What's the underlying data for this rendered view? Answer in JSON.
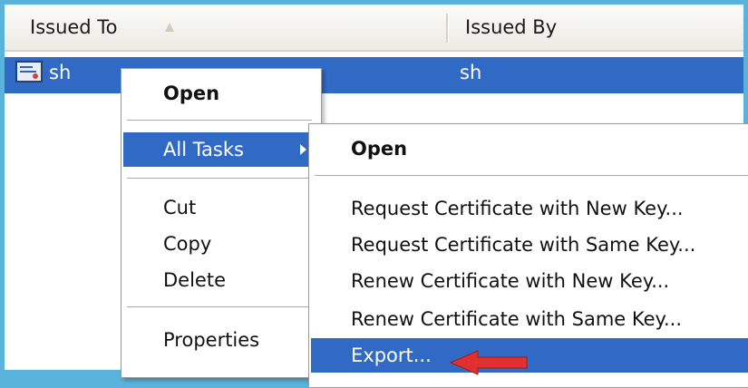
{
  "list": {
    "columns": {
      "issued_to": "Issued To",
      "issued_by": "Issued By"
    },
    "sort_icon": "sort-ascending-icon",
    "selected_row": {
      "issued_to": "sh",
      "issued_by": "sh",
      "icon": "certificate-icon"
    }
  },
  "context_menu": {
    "open": "Open",
    "all_tasks": "All Tasks",
    "cut": "Cut",
    "copy": "Copy",
    "delete": "Delete",
    "properties": "Properties"
  },
  "submenu": {
    "open": "Open",
    "request_new": "Request Certificate with New Key...",
    "request_same": "Request Certificate with Same Key...",
    "renew_new": "Renew Certificate with New Key...",
    "renew_same": "Renew Certificate with Same Key...",
    "export": "Export..."
  },
  "colors": {
    "selection": "#316ac5",
    "annotation_arrow": "#e03030",
    "frame": "#5ab3da"
  }
}
